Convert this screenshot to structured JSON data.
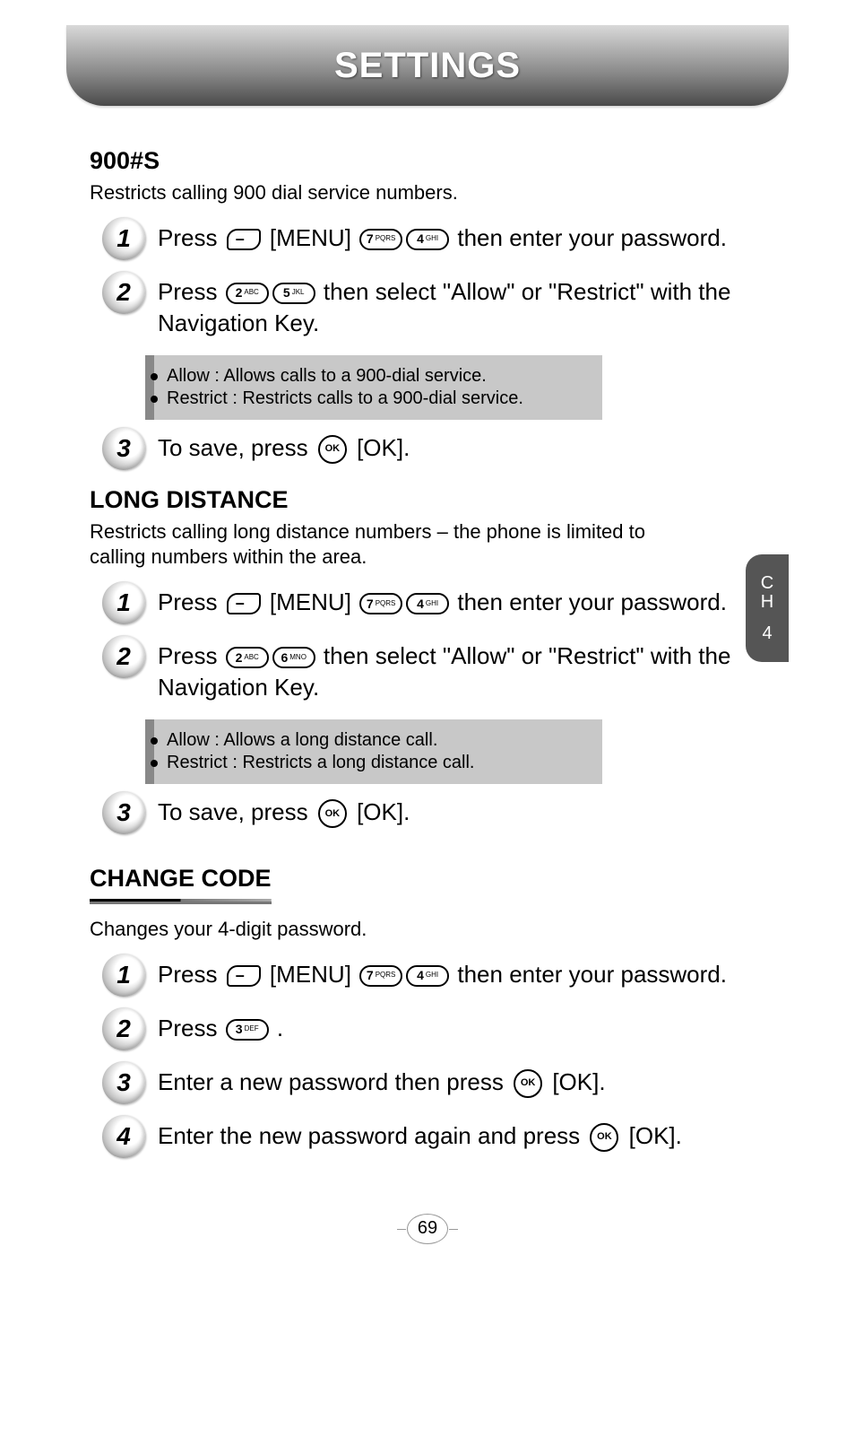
{
  "header": {
    "title": "SETTINGS"
  },
  "sideTab": {
    "line1": "C",
    "line2": "H",
    "line3": "4"
  },
  "pageNumber": "69",
  "sections": [
    {
      "heading": "900#S",
      "desc": "Restricts calling 900 dial service numbers.",
      "steps": [
        {
          "num": "1",
          "pre": "Press ",
          "menuLabel": " [MENU] ",
          "keys": [
            {
              "big": "7",
              "tiny": "PQRS"
            },
            {
              "big": "4",
              "tiny": "GHI"
            }
          ],
          "post": " then enter your password."
        },
        {
          "num": "2",
          "pre": "Press ",
          "keys": [
            {
              "big": "2",
              "tiny": "ABC"
            },
            {
              "big": "5",
              "tiny": "JKL"
            }
          ],
          "post": " then select \"Allow\" or \"Restrict\" with the Navigation Key.",
          "note": [
            "Allow : Allows calls to a 900-dial service.",
            "Restrict : Restricts calls to a 900-dial service."
          ]
        },
        {
          "num": "3",
          "pre": "To save, press ",
          "okLabel": " [OK]."
        }
      ]
    },
    {
      "heading": "LONG DISTANCE",
      "desc": "Restricts calling long distance numbers – the phone is limited to calling numbers within the area.",
      "steps": [
        {
          "num": "1",
          "pre": "Press ",
          "menuLabel": " [MENU] ",
          "keys": [
            {
              "big": "7",
              "tiny": "PQRS"
            },
            {
              "big": "4",
              "tiny": "GHI"
            }
          ],
          "post": " then enter your password."
        },
        {
          "num": "2",
          "pre": "Press ",
          "keys": [
            {
              "big": "2",
              "tiny": "ABC"
            },
            {
              "big": "6",
              "tiny": "MNO"
            }
          ],
          "post": " then select \"Allow\" or \"Restrict\" with the Navigation Key.",
          "note": [
            "Allow : Allows a long distance call.",
            "Restrict : Restricts a long distance call."
          ]
        },
        {
          "num": "3",
          "pre": "To save, press ",
          "okLabel": " [OK]."
        }
      ]
    },
    {
      "heading": "CHANGE CODE",
      "underlined": true,
      "desc": "Changes your 4-digit password.",
      "steps": [
        {
          "num": "1",
          "pre": "Press ",
          "menuLabel": " [MENU] ",
          "keys": [
            {
              "big": "7",
              "tiny": "PQRS"
            },
            {
              "big": "4",
              "tiny": "GHI"
            }
          ],
          "post": " then enter your password."
        },
        {
          "num": "2",
          "pre": "Press ",
          "keys": [
            {
              "big": "3",
              "tiny": "DEF"
            }
          ],
          "post": " ."
        },
        {
          "num": "3",
          "pre": "Enter a new password then press ",
          "okLabel": " [OK]."
        },
        {
          "num": "4",
          "pre": "Enter the new password again and press ",
          "okLabel": " [OK]."
        }
      ]
    }
  ]
}
